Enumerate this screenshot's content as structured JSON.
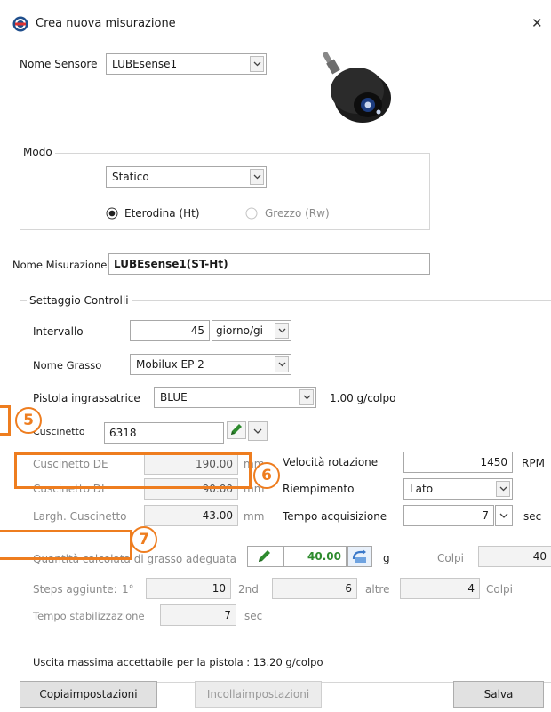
{
  "window": {
    "title": "Crea nuova misurazione",
    "close_glyph": "✕"
  },
  "sensor": {
    "label": "Nome Sensore",
    "value": "LUBEsense1"
  },
  "mode": {
    "group_title": "Modo",
    "value": "Statico",
    "radio_heterodyne": "Eterodina (Ht)",
    "radio_raw": "Grezzo (Rw)"
  },
  "measurement": {
    "label": "Nome Misurazione",
    "value": "LUBEsense1(ST-Ht)"
  },
  "settings": {
    "group_title": "Settaggio Controlli",
    "interval_label": "Intervallo",
    "interval_value": "45",
    "interval_unit": "giorno/gi",
    "grease_label": "Nome Grasso",
    "grease_value": "Mobilux EP 2",
    "gun_label": "Pistola ingrassatrice",
    "gun_value": "BLUE",
    "gun_rate": "1.00 g/colpo",
    "bearing_label": "Cuscinetto",
    "bearing_value": "6318",
    "bearing_de_label": "Cuscinetto DE",
    "bearing_de_value": "190.00",
    "bearing_de_unit": "mm",
    "bearing_di_label": "Cuscinetto DI",
    "bearing_di_value": "90.00",
    "bearing_di_unit": "mm",
    "bearing_width_label": "Largh. Cuscinetto",
    "bearing_width_value": "43.00",
    "bearing_width_unit": "mm",
    "speed_label": "Velocità rotazione",
    "speed_value": "1450",
    "speed_unit": "RPM",
    "fill_label": "Riempimento",
    "fill_value": "Lato",
    "acq_label": "Tempo acquisizione",
    "acq_value": "7",
    "acq_unit": "sec",
    "qty_label": "Quantità calcolata di grasso adeguata",
    "qty_value": "40.00",
    "qty_unit": "g",
    "shots_label": "Colpi",
    "shots_value": "40",
    "steps_label": "Steps aggiunte:",
    "step1_label": "1°",
    "step1_value": "10",
    "step2_label": "2nd",
    "step2_value": "6",
    "step3_label": "altre",
    "step3_value": "4",
    "steps_unit": "Colpi",
    "stab_label": "Tempo stabilizzazione",
    "stab_value": "7",
    "stab_unit": "sec",
    "max_output": "Uscita massima accettabile per la pistola : 13.20 g/colpo"
  },
  "buttons": {
    "copy": "Copiaimpostazioni",
    "paste": "Incollaimpostazioni",
    "save": "Salva"
  },
  "annotations": {
    "badge5": "5",
    "badge6": "6",
    "badge7": "7",
    "color": "#ee7d1f"
  }
}
